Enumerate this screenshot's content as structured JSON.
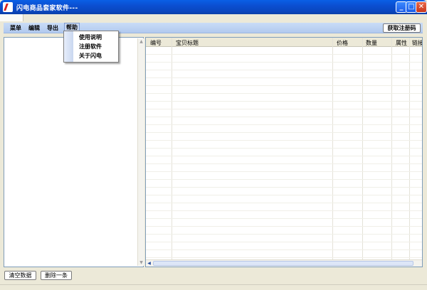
{
  "window": {
    "title": "闪电商品套家软件---",
    "controls": {
      "minimize": "_",
      "maximize": "□",
      "close": "✕"
    }
  },
  "menubar": {
    "items": [
      "菜单",
      "编辑",
      "导出",
      "帮助"
    ],
    "active": "帮助",
    "get_code_label": "获取注册码"
  },
  "help_menu": {
    "items": [
      "使用说明",
      "注册软件",
      "关于闪电"
    ]
  },
  "table": {
    "columns": [
      "编号",
      "宝贝标题",
      "价格",
      "数量",
      "属性",
      "链接"
    ],
    "rows": []
  },
  "buttons": {
    "clear_data": "清空数据",
    "delete_one": "删除一条"
  },
  "colors": {
    "titlebar": "#0b4fd0",
    "menubar": "#b1c9ee",
    "panel_border": "#7f9db9"
  }
}
